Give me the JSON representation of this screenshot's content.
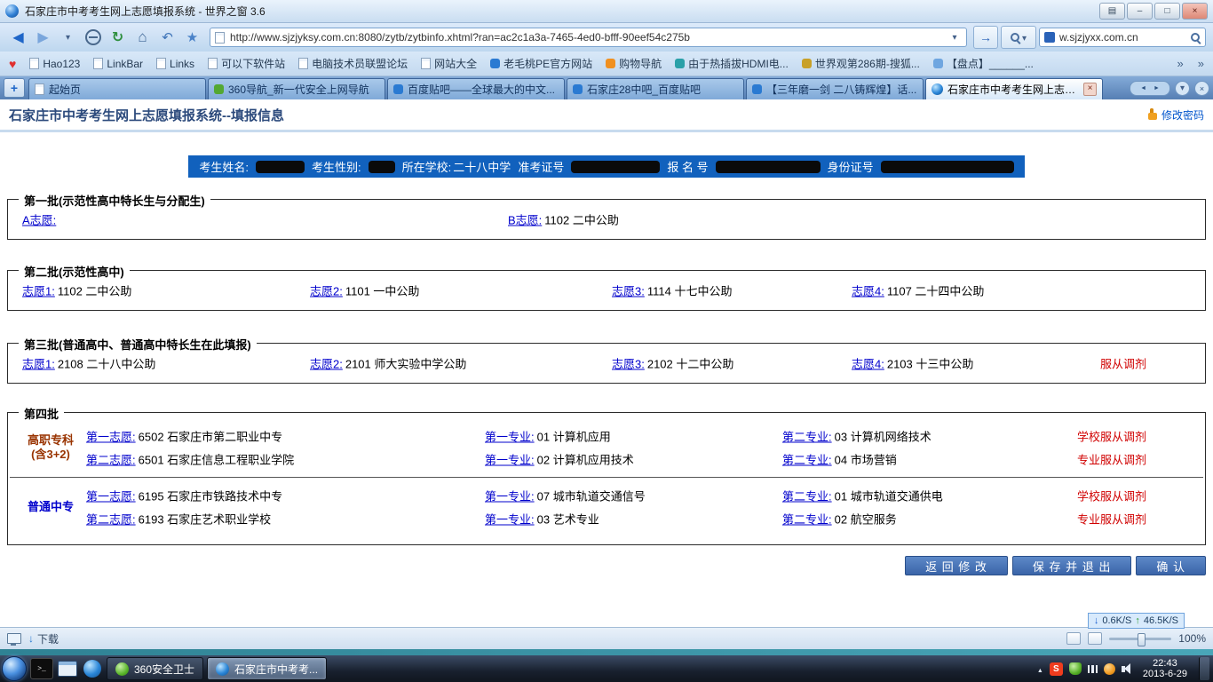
{
  "window": {
    "title": "石家庄市中考考生网上志愿填报系统 - 世界之窗 3.6"
  },
  "nav": {
    "url": "http://www.sjzjyksy.com.cn:8080/zytb/zytbinfo.xhtml?ran=ac2c1a3a-7465-4ed0-bfff-90eef54c275b",
    "search_value": "w.sjzjyxx.com.cn"
  },
  "icons": {
    "back": "◀",
    "forward": "▶",
    "stop": "circle-slash",
    "refresh": "↻",
    "home": "⌂",
    "undo": "↶",
    "favorites-star": "★",
    "go": "→",
    "heart": "♥",
    "search": "magnifier",
    "lock": "padlock",
    "new-tab": "+",
    "close": "×",
    "minimize": "–",
    "maximize": "□",
    "menu": "▤",
    "overflow": "»",
    "download": "↓",
    "upload": "↑"
  },
  "bookmarks": {
    "items": [
      {
        "label": "Hao123"
      },
      {
        "label": "LinkBar"
      },
      {
        "label": "Links"
      },
      {
        "label": "可以下软件站"
      },
      {
        "label": "电脑技术员联盟论坛"
      },
      {
        "label": "网站大全"
      },
      {
        "label": "老毛桃PE官方网站"
      },
      {
        "label": "购物导航"
      },
      {
        "label": "由于热插拔HDMI电..."
      },
      {
        "label": "世界观第286期-搜狐..."
      },
      {
        "label": "【盘点】______..."
      }
    ]
  },
  "tabs": [
    {
      "label": "起始页"
    },
    {
      "label": "360导航_新一代安全上网导航"
    },
    {
      "label": "百度贴吧——全球最大的中文..."
    },
    {
      "label": "石家庄28中吧_百度贴吧"
    },
    {
      "label": "【三年磨一剑 二八铸辉煌】话..."
    },
    {
      "label": "石家庄市中考考生网上志愿填...",
      "active": true
    }
  ],
  "page": {
    "title": "石家庄市中考考生网上志愿填报系统--填报信息",
    "change_password": "修改密码",
    "student": {
      "name_label": "考生姓名:",
      "gender_label": "考生性别:",
      "school_label": "所在学校:",
      "school_value": "二十八中学",
      "ticket_label": "准考证号",
      "reg_label": "报 名 号",
      "id_label": "身份证号"
    },
    "batch1": {
      "title": "第一批(示范性高中特长生与分配生)",
      "a_label": "A志愿:",
      "b_label": "B志愿:",
      "b_value": "1102 二中公助"
    },
    "batch2": {
      "title": "第二批(示范性高中)",
      "items": [
        {
          "label": "志愿1:",
          "value": "1102 二中公助"
        },
        {
          "label": "志愿2:",
          "value": "1101 一中公助"
        },
        {
          "label": "志愿3:",
          "value": "1114 十七中公助"
        },
        {
          "label": "志愿4:",
          "value": "1107 二十四中公助"
        }
      ]
    },
    "batch3": {
      "title": "第三批(普通高中、普通高中特长生在此填报)",
      "items": [
        {
          "label": "志愿1:",
          "value": "2108 二十八中公助"
        },
        {
          "label": "志愿2:",
          "value": "2101 师大实验中学公助"
        },
        {
          "label": "志愿3:",
          "value": "2102 十二中公助"
        },
        {
          "label": "志愿4:",
          "value": "2103 十三中公助"
        }
      ],
      "adjust": "服从调剂"
    },
    "batch4": {
      "title": "第四批",
      "groups": [
        {
          "name": "高职专科\n(含3+2)",
          "rows": [
            {
              "choice_label": "第一志愿:",
              "choice_value": "6502 石家庄市第二职业中专",
              "major1_label": "第一专业:",
              "major1_value": "01 计算机应用",
              "major2_label": "第二专业:",
              "major2_value": "03 计算机网络技术",
              "adjust": "学校服从调剂"
            },
            {
              "choice_label": "第二志愿:",
              "choice_value": "6501 石家庄信息工程职业学院",
              "major1_label": "第一专业:",
              "major1_value": "02 计算机应用技术",
              "major2_label": "第二专业:",
              "major2_value": "04 市场营销",
              "adjust": "专业服从调剂"
            }
          ]
        },
        {
          "name": "普通中专",
          "rows": [
            {
              "choice_label": "第一志愿:",
              "choice_value": "6195 石家庄市铁路技术中专",
              "major1_label": "第一专业:",
              "major1_value": "07 城市轨道交通信号",
              "major2_label": "第二专业:",
              "major2_value": "01 城市轨道交通供电",
              "adjust": "学校服从调剂"
            },
            {
              "choice_label": "第二志愿:",
              "choice_value": "6193 石家庄艺术职业学校",
              "major1_label": "第一专业:",
              "major1_value": "03 艺术专业",
              "major2_label": "第二专业:",
              "major2_value": "02 航空服务",
              "adjust": "专业服从调剂"
            }
          ]
        }
      ]
    },
    "actions": {
      "back_modify": "返 回 修 改",
      "save_exit": "保 存 并 退 出",
      "confirm": "确 认"
    }
  },
  "statusbar": {
    "download_label": "下载",
    "down_speed": "0.6K/S",
    "up_speed": "46.5K/S",
    "zoom": "100%"
  },
  "taskbar": {
    "apps": [
      {
        "label": "360安全卫士"
      },
      {
        "label": "石家庄市中考考...",
        "active": true
      }
    ],
    "clock_time": "22:43",
    "clock_date": "2013-6-29"
  }
}
